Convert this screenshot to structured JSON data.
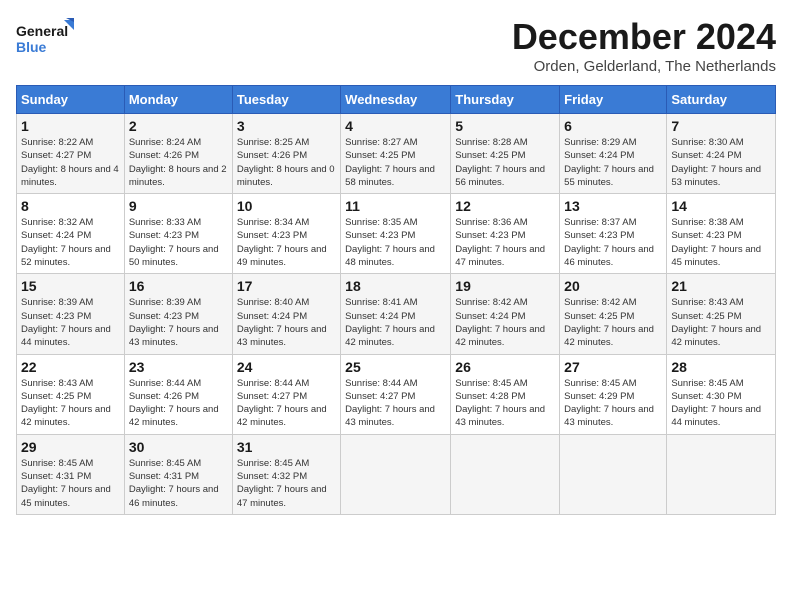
{
  "header": {
    "logo_general": "General",
    "logo_blue": "Blue",
    "month_title": "December 2024",
    "location": "Orden, Gelderland, The Netherlands"
  },
  "calendar": {
    "days_of_week": [
      "Sunday",
      "Monday",
      "Tuesday",
      "Wednesday",
      "Thursday",
      "Friday",
      "Saturday"
    ],
    "weeks": [
      [
        {
          "day": "1",
          "sunrise": "Sunrise: 8:22 AM",
          "sunset": "Sunset: 4:27 PM",
          "daylight": "Daylight: 8 hours and 4 minutes."
        },
        {
          "day": "2",
          "sunrise": "Sunrise: 8:24 AM",
          "sunset": "Sunset: 4:26 PM",
          "daylight": "Daylight: 8 hours and 2 minutes."
        },
        {
          "day": "3",
          "sunrise": "Sunrise: 8:25 AM",
          "sunset": "Sunset: 4:26 PM",
          "daylight": "Daylight: 8 hours and 0 minutes."
        },
        {
          "day": "4",
          "sunrise": "Sunrise: 8:27 AM",
          "sunset": "Sunset: 4:25 PM",
          "daylight": "Daylight: 7 hours and 58 minutes."
        },
        {
          "day": "5",
          "sunrise": "Sunrise: 8:28 AM",
          "sunset": "Sunset: 4:25 PM",
          "daylight": "Daylight: 7 hours and 56 minutes."
        },
        {
          "day": "6",
          "sunrise": "Sunrise: 8:29 AM",
          "sunset": "Sunset: 4:24 PM",
          "daylight": "Daylight: 7 hours and 55 minutes."
        },
        {
          "day": "7",
          "sunrise": "Sunrise: 8:30 AM",
          "sunset": "Sunset: 4:24 PM",
          "daylight": "Daylight: 7 hours and 53 minutes."
        }
      ],
      [
        {
          "day": "8",
          "sunrise": "Sunrise: 8:32 AM",
          "sunset": "Sunset: 4:24 PM",
          "daylight": "Daylight: 7 hours and 52 minutes."
        },
        {
          "day": "9",
          "sunrise": "Sunrise: 8:33 AM",
          "sunset": "Sunset: 4:23 PM",
          "daylight": "Daylight: 7 hours and 50 minutes."
        },
        {
          "day": "10",
          "sunrise": "Sunrise: 8:34 AM",
          "sunset": "Sunset: 4:23 PM",
          "daylight": "Daylight: 7 hours and 49 minutes."
        },
        {
          "day": "11",
          "sunrise": "Sunrise: 8:35 AM",
          "sunset": "Sunset: 4:23 PM",
          "daylight": "Daylight: 7 hours and 48 minutes."
        },
        {
          "day": "12",
          "sunrise": "Sunrise: 8:36 AM",
          "sunset": "Sunset: 4:23 PM",
          "daylight": "Daylight: 7 hours and 47 minutes."
        },
        {
          "day": "13",
          "sunrise": "Sunrise: 8:37 AM",
          "sunset": "Sunset: 4:23 PM",
          "daylight": "Daylight: 7 hours and 46 minutes."
        },
        {
          "day": "14",
          "sunrise": "Sunrise: 8:38 AM",
          "sunset": "Sunset: 4:23 PM",
          "daylight": "Daylight: 7 hours and 45 minutes."
        }
      ],
      [
        {
          "day": "15",
          "sunrise": "Sunrise: 8:39 AM",
          "sunset": "Sunset: 4:23 PM",
          "daylight": "Daylight: 7 hours and 44 minutes."
        },
        {
          "day": "16",
          "sunrise": "Sunrise: 8:39 AM",
          "sunset": "Sunset: 4:23 PM",
          "daylight": "Daylight: 7 hours and 43 minutes."
        },
        {
          "day": "17",
          "sunrise": "Sunrise: 8:40 AM",
          "sunset": "Sunset: 4:24 PM",
          "daylight": "Daylight: 7 hours and 43 minutes."
        },
        {
          "day": "18",
          "sunrise": "Sunrise: 8:41 AM",
          "sunset": "Sunset: 4:24 PM",
          "daylight": "Daylight: 7 hours and 42 minutes."
        },
        {
          "day": "19",
          "sunrise": "Sunrise: 8:42 AM",
          "sunset": "Sunset: 4:24 PM",
          "daylight": "Daylight: 7 hours and 42 minutes."
        },
        {
          "day": "20",
          "sunrise": "Sunrise: 8:42 AM",
          "sunset": "Sunset: 4:25 PM",
          "daylight": "Daylight: 7 hours and 42 minutes."
        },
        {
          "day": "21",
          "sunrise": "Sunrise: 8:43 AM",
          "sunset": "Sunset: 4:25 PM",
          "daylight": "Daylight: 7 hours and 42 minutes."
        }
      ],
      [
        {
          "day": "22",
          "sunrise": "Sunrise: 8:43 AM",
          "sunset": "Sunset: 4:25 PM",
          "daylight": "Daylight: 7 hours and 42 minutes."
        },
        {
          "day": "23",
          "sunrise": "Sunrise: 8:44 AM",
          "sunset": "Sunset: 4:26 PM",
          "daylight": "Daylight: 7 hours and 42 minutes."
        },
        {
          "day": "24",
          "sunrise": "Sunrise: 8:44 AM",
          "sunset": "Sunset: 4:27 PM",
          "daylight": "Daylight: 7 hours and 42 minutes."
        },
        {
          "day": "25",
          "sunrise": "Sunrise: 8:44 AM",
          "sunset": "Sunset: 4:27 PM",
          "daylight": "Daylight: 7 hours and 43 minutes."
        },
        {
          "day": "26",
          "sunrise": "Sunrise: 8:45 AM",
          "sunset": "Sunset: 4:28 PM",
          "daylight": "Daylight: 7 hours and 43 minutes."
        },
        {
          "day": "27",
          "sunrise": "Sunrise: 8:45 AM",
          "sunset": "Sunset: 4:29 PM",
          "daylight": "Daylight: 7 hours and 43 minutes."
        },
        {
          "day": "28",
          "sunrise": "Sunrise: 8:45 AM",
          "sunset": "Sunset: 4:30 PM",
          "daylight": "Daylight: 7 hours and 44 minutes."
        }
      ],
      [
        {
          "day": "29",
          "sunrise": "Sunrise: 8:45 AM",
          "sunset": "Sunset: 4:31 PM",
          "daylight": "Daylight: 7 hours and 45 minutes."
        },
        {
          "day": "30",
          "sunrise": "Sunrise: 8:45 AM",
          "sunset": "Sunset: 4:31 PM",
          "daylight": "Daylight: 7 hours and 46 minutes."
        },
        {
          "day": "31",
          "sunrise": "Sunrise: 8:45 AM",
          "sunset": "Sunset: 4:32 PM",
          "daylight": "Daylight: 7 hours and 47 minutes."
        },
        null,
        null,
        null,
        null
      ]
    ]
  }
}
